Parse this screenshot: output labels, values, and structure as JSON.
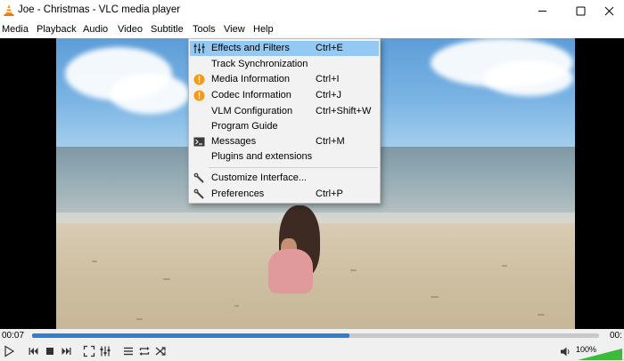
{
  "window": {
    "title": "Joe - Christmas - VLC media player",
    "minimize_label": "minimize",
    "maximize_label": "maximize",
    "close_label": "close"
  },
  "menubar": {
    "items": [
      "Media",
      "Playback",
      "Audio",
      "Video",
      "Subtitle",
      "Tools",
      "View",
      "Help"
    ]
  },
  "tools_menu": {
    "items": [
      {
        "label": "Effects and Filters",
        "shortcut": "Ctrl+E",
        "icon": "equalizer-icon",
        "highlighted": true
      },
      {
        "label": "Track Synchronization",
        "shortcut": "",
        "icon": ""
      },
      {
        "label": "Media Information",
        "shortcut": "Ctrl+I",
        "icon": "info-icon"
      },
      {
        "label": "Codec Information",
        "shortcut": "Ctrl+J",
        "icon": "info-icon"
      },
      {
        "label": "VLM Configuration",
        "shortcut": "Ctrl+Shift+W",
        "icon": ""
      },
      {
        "label": "Program Guide",
        "shortcut": "",
        "icon": ""
      },
      {
        "label": "Messages",
        "shortcut": "Ctrl+M",
        "icon": "terminal-icon"
      },
      {
        "label": "Plugins and extensions",
        "shortcut": "",
        "icon": ""
      },
      {
        "label": "Customize Interface...",
        "shortcut": "",
        "icon": "wrench-icon"
      },
      {
        "label": "Preferences",
        "shortcut": "Ctrl+P",
        "icon": "wrench-icon"
      }
    ]
  },
  "playback": {
    "elapsed": "00:07",
    "remaining": "00:",
    "progress": 0.56,
    "volume_label": "100%",
    "volume_level": 1.0
  },
  "colors": {
    "accent": "#2f7fd0",
    "menu_highlight": "#93c9f3",
    "info_orange": "#f39a1d"
  }
}
